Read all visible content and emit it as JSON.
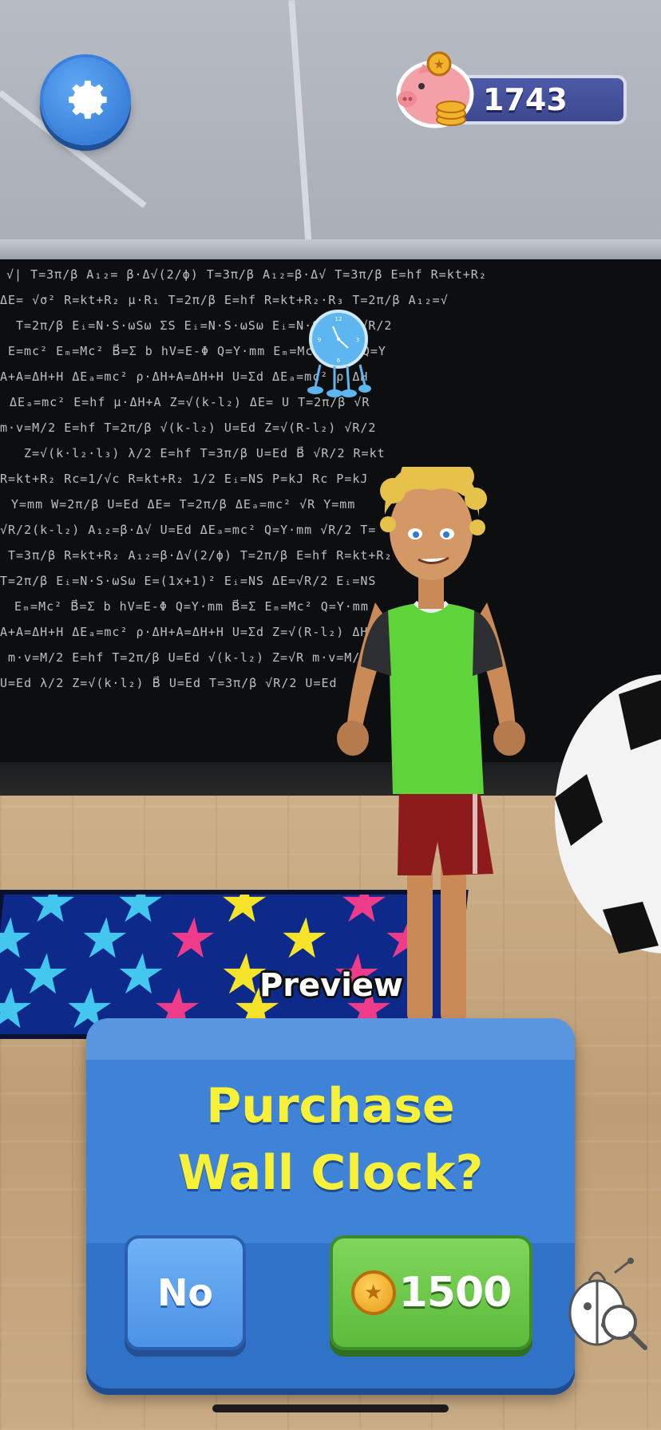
{
  "hud": {
    "settings": {
      "icon": "gear-icon"
    },
    "coins": {
      "icon": "piggy-bank-icon",
      "value": "1743"
    }
  },
  "scene": {
    "preview_label": "Preview"
  },
  "dialog": {
    "title_line1": "Purchase",
    "title_line2": "Wall Clock?",
    "no_label": "No",
    "price": "1500",
    "price_icon": "coin-icon"
  },
  "colors": {
    "dialog_blue": "#3e83d8",
    "title_yellow": "#f8f13a",
    "no_button": "#5fa3ee",
    "buy_button": "#6cc84a"
  }
}
